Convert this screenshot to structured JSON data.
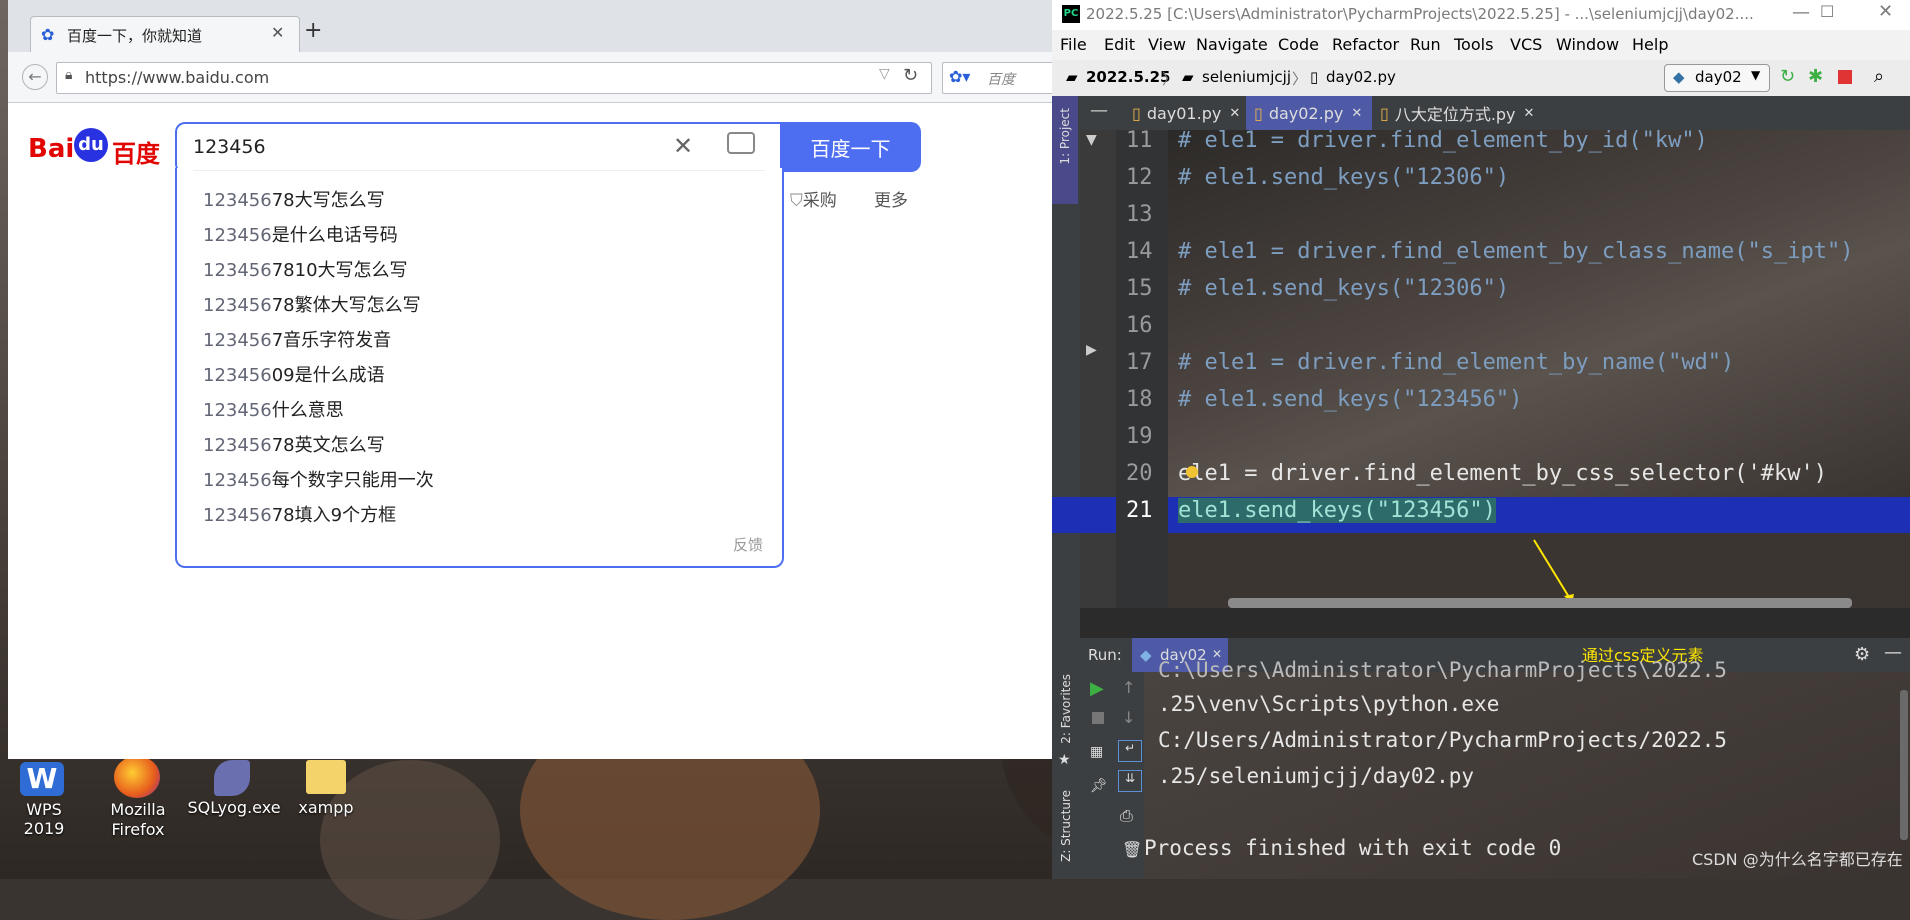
{
  "browser": {
    "tab_title": "百度一下，你就知道",
    "url": "https://www.baidu.com",
    "search_engine_placeholder": "百度",
    "baidu": {
      "logo_text": "百度",
      "logo_latin": "Bai",
      "logo_du": "du",
      "query": "123456",
      "button_label": "百度一下",
      "side_links": [
        "采购",
        "更多"
      ],
      "feedback": "反馈",
      "suggestions": [
        {
          "prefix": "123456",
          "rest": "78大写怎么写"
        },
        {
          "prefix": "123456",
          "rest": "是什么电话号码"
        },
        {
          "prefix": "123456",
          "rest": "7810大写怎么写"
        },
        {
          "prefix": "123456",
          "rest": "78繁体大写怎么写"
        },
        {
          "prefix": "123456",
          "rest": "7音乐字符发音"
        },
        {
          "prefix": "123456",
          "rest": "09是什么成语"
        },
        {
          "prefix": "123456",
          "rest": "什么意思"
        },
        {
          "prefix": "123456",
          "rest": "78英文怎么写"
        },
        {
          "prefix": "123456",
          "rest": "每个数字只能用一次"
        },
        {
          "prefix": "123456",
          "rest": "78填入9个方框"
        }
      ]
    }
  },
  "desktop": {
    "icons": [
      "WPS 2019",
      "Mozilla Firefox",
      "SQLyog.exe",
      "xampp"
    ]
  },
  "ide": {
    "title": "2022.5.25 [C:\\Users\\Administrator\\PycharmProjects\\2022.5.25] - ...\\seleniumjcjj\\day02....",
    "menu": [
      "File",
      "Edit",
      "View",
      "Navigate",
      "Code",
      "Refactor",
      "Run",
      "Tools",
      "VCS",
      "Window",
      "Help"
    ],
    "breadcrumb": [
      "2022.5.25",
      "seleniumjcjj",
      "day02.py"
    ],
    "run_config": "day02",
    "tabs": [
      "day01.py",
      "day02.py",
      "八大定位方式.py"
    ],
    "side_project": "1: Project",
    "side_favorites": "2: Favorites",
    "side_structure": "Z: Structure",
    "code_lines": [
      {
        "n": "11",
        "t": "# ele1 = driver.find_element_by_id(\"kw\")",
        "kind": "cmt"
      },
      {
        "n": "12",
        "t": "# ele1.send_keys(\"12306\")",
        "kind": "cmt"
      },
      {
        "n": "13",
        "t": "",
        "kind": "pln"
      },
      {
        "n": "14",
        "t": "# ele1 = driver.find_element_by_class_name(\"s_ipt\")",
        "kind": "cmt"
      },
      {
        "n": "15",
        "t": "# ele1.send_keys(\"12306\")",
        "kind": "cmt"
      },
      {
        "n": "16",
        "t": "",
        "kind": "pln"
      },
      {
        "n": "17",
        "t": "# ele1 = driver.find_element_by_name(\"wd\")",
        "kind": "cmt"
      },
      {
        "n": "18",
        "t": "# ele1.send_keys(\"123456\")",
        "kind": "cmt"
      },
      {
        "n": "19",
        "t": "",
        "kind": "pln"
      },
      {
        "n": "20",
        "t": "ele1 = driver.find_element_by_css_selector('#kw')",
        "kind": "pln"
      },
      {
        "n": "21",
        "t": "ele1.send_keys(\"123456\")",
        "kind": "pln"
      }
    ],
    "annotation": "通过css定义元素",
    "run_label": "Run:",
    "run_tab": "day02",
    "console_lines": [
      "C:\\Users\\Administrator\\PycharmProjects\\2022.5",
      ".25\\venv\\Scripts\\python.exe",
      "C:/Users/Administrator/PycharmProjects/2022.5",
      ".25/seleniumjcjj/day02.py",
      "",
      "Process finished with exit code 0"
    ],
    "watermark": "CSDN @为什么名字都已存在"
  }
}
